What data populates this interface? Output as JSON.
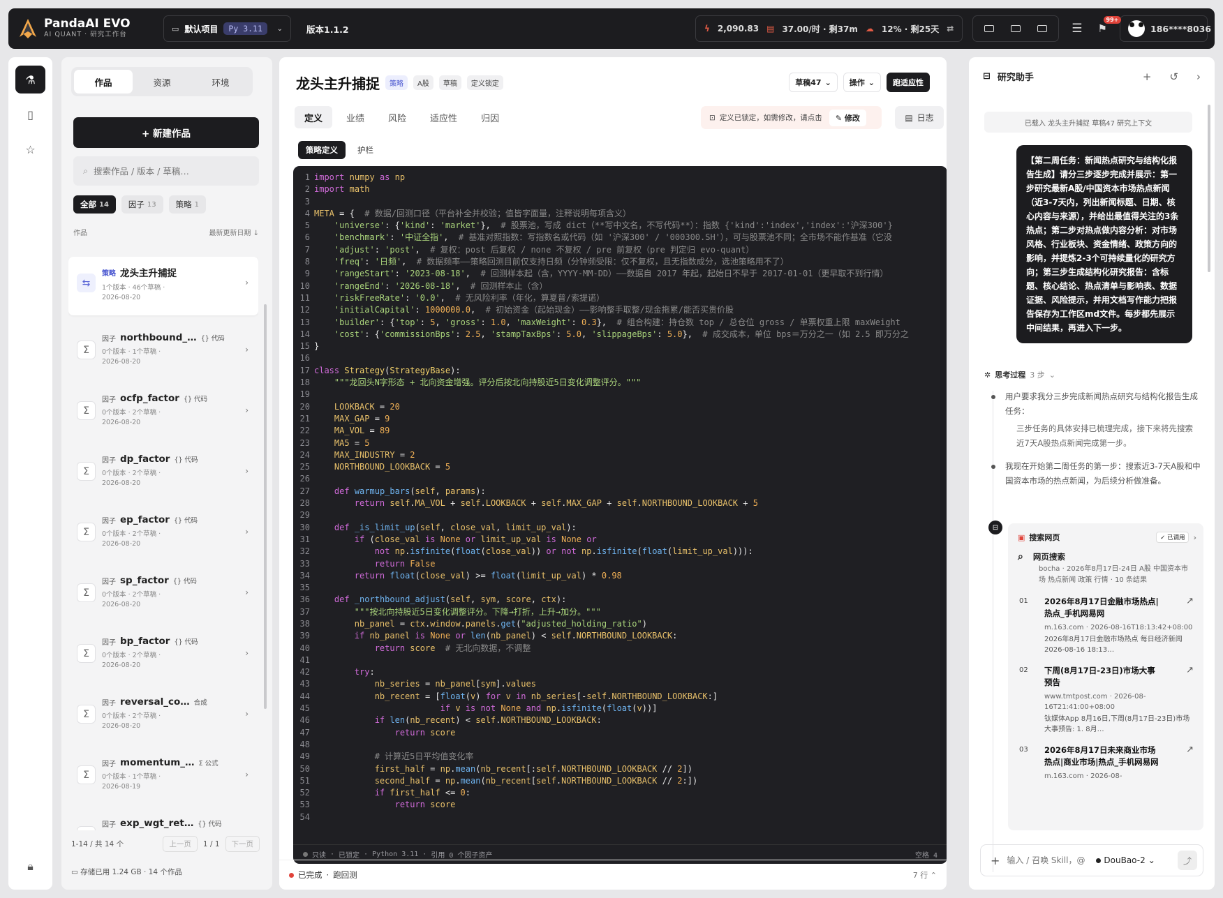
{
  "brand": {
    "name": "PandaAI EVO",
    "subtitle": "AI QUANT · 研究工作台"
  },
  "topbar": {
    "project": "默认项目",
    "python": "Py 3.11",
    "version": "版本1.1.2",
    "stat_points": "2,090.83",
    "stat_rate": "37.00/时 · 剩37m",
    "stat_pct": "12% · 剩25天",
    "notif_badge": "99+",
    "user": "186****8036"
  },
  "left": {
    "tabs": [
      "作品",
      "资源",
      "环境"
    ],
    "new_button": "+ 新建作品",
    "search_placeholder": "搜索作品 / 版本 / 草稿…",
    "filters": [
      {
        "label": "全部",
        "count": "14"
      },
      {
        "label": "因子",
        "count": "13"
      },
      {
        "label": "策略",
        "count": "1"
      }
    ],
    "list_header_left": "作品",
    "list_header_right": "最新更新日期 ↓",
    "items": [
      {
        "kind": "策略",
        "name": "龙头主升捕捉",
        "tag": "",
        "meta": "1个版本 · 46个草稿 ·",
        "date": "2026-08-20"
      },
      {
        "kind": "因子",
        "name": "northbound_…",
        "tag": "{} 代码",
        "meta": "0个版本 · 1个草稿 ·",
        "date": "2026-08-20"
      },
      {
        "kind": "因子",
        "name": "ocfp_factor",
        "tag": "{} 代码",
        "meta": "0个版本 · 2个草稿 ·",
        "date": "2026-08-20"
      },
      {
        "kind": "因子",
        "name": "dp_factor",
        "tag": "{} 代码",
        "meta": "0个版本 · 2个草稿 ·",
        "date": "2026-08-20"
      },
      {
        "kind": "因子",
        "name": "ep_factor",
        "tag": "{} 代码",
        "meta": "0个版本 · 2个草稿 ·",
        "date": "2026-08-20"
      },
      {
        "kind": "因子",
        "name": "sp_factor",
        "tag": "{} 代码",
        "meta": "0个版本 · 2个草稿 ·",
        "date": "2026-08-20"
      },
      {
        "kind": "因子",
        "name": "bp_factor",
        "tag": "{} 代码",
        "meta": "0个版本 · 2个草稿 ·",
        "date": "2026-08-20"
      },
      {
        "kind": "因子",
        "name": "reversal_co…",
        "tag": "合成",
        "meta": "0个版本 · 2个草稿 ·",
        "date": "2026-08-20"
      },
      {
        "kind": "因子",
        "name": "momentum_…",
        "tag": "Σ 公式",
        "meta": "0个版本 · 1个草稿 ·",
        "date": "2026-08-19"
      },
      {
        "kind": "因子",
        "name": "exp_wgt_ret…",
        "tag": "{} 代码",
        "meta": "",
        "date": ""
      }
    ],
    "pager_info": "1-14 / 共 14 个",
    "prev": "上一页",
    "page": "1 / 1",
    "next": "下一页",
    "storage": "存储已用 1.24 GB · 14 个作品"
  },
  "center": {
    "title": "龙头主升捕捉",
    "tags": [
      "策略",
      "A股",
      "草稿",
      "定义锁定"
    ],
    "draft_btn": "草稿47",
    "ops_btn": "操作",
    "run_btn": "跑适应性",
    "tabs": [
      "定义",
      "业绩",
      "风险",
      "适应性",
      "归因"
    ],
    "lock_text": "定义已锁定，如需修改，请点击",
    "edit_btn": "修改",
    "log_btn": "日志",
    "subtabs": [
      "策略定义",
      "护栏"
    ],
    "status": {
      "mode": "只读",
      "locked": "已锁定",
      "python": "Python 3.11",
      "refs": "引用 0 个因子资产",
      "indent": "空格 4"
    },
    "footer_status": "已完成",
    "footer_action": "跑回测",
    "footer_lines": "7 行"
  },
  "code": [
    "<span class=\"k\">import</span> <span class=\"v\">numpy</span> <span class=\"k\">as</span> <span class=\"v\">np</span>",
    "<span class=\"k\">import</span> <span class=\"v\">math</span>",
    "",
    "<span class=\"v\">META</span> = {  <span class=\"c\"># 数据/回测口径（平台补全并校验；值皆字面量，注释说明每项含义）</span>",
    "    <span class=\"s\">'universe'</span>: {<span class=\"s\">'kind'</span>: <span class=\"s\">'market'</span>},  <span class=\"c\"># 股票池，写成 dict（**写中文名，不写代码**）：指数 {'kind':'index','index':'沪深300'}</span>",
    "    <span class=\"s\">'benchmark'</span>: <span class=\"s\">'中证全指'</span>,  <span class=\"c\"># 基准对照指数：写指数名或代码（如 '沪深300' / '000300.SH'），可与股票池不同；全市场不能作基准（它没</span>",
    "    <span class=\"s\">'adjust'</span>: <span class=\"s\">'post'</span>,  <span class=\"c\"># 复权：post 后复权 / none 不复权 / pre 前复权（pre 判定归 evo-quant）</span>",
    "    <span class=\"s\">'freq'</span>: <span class=\"s\">'日频'</span>,  <span class=\"c\"># 数据频率——策略回测目前仅支持日频（分钟频受限：仅不复权，且无指数成分，选池策略用不了）</span>",
    "    <span class=\"s\">'rangeStart'</span>: <span class=\"s\">'2023-08-18'</span>,  <span class=\"c\"># 回测样本起（含，YYYY-MM-DD）——数据自 2017 年起，起始日不早于 2017-01-01（更早取不到行情）</span>",
    "    <span class=\"s\">'rangeEnd'</span>: <span class=\"s\">'2026-08-18'</span>,  <span class=\"c\"># 回测样本止（含）</span>",
    "    <span class=\"s\">'riskFreeRate'</span>: <span class=\"s\">'0.0'</span>,  <span class=\"c\"># 无风险利率（年化，算夏普/索提诺）</span>",
    "    <span class=\"s\">'initialCapital'</span>: <span class=\"n\">1000000.0</span>,  <span class=\"c\"># 初始资金（起始现金）——影响整手取整/现金拖累/能否买贵价股</span>",
    "    <span class=\"s\">'builder'</span>: {<span class=\"s\">'top'</span>: <span class=\"n\">5</span>, <span class=\"s\">'gross'</span>: <span class=\"n\">1.0</span>, <span class=\"s\">'maxWeight'</span>: <span class=\"n\">0.3</span>},  <span class=\"c\"># 组合构建：持仓数 top / 总仓位 gross / 单票权重上限 maxWeight</span>",
    "    <span class=\"s\">'cost'</span>: {<span class=\"s\">'commissionBps'</span>: <span class=\"n\">2.5</span>, <span class=\"s\">'stampTaxBps'</span>: <span class=\"n\">5.0</span>, <span class=\"s\">'slippageBps'</span>: <span class=\"n\">5.0</span>},  <span class=\"c\"># 成交成本，单位 bps＝万分之一（如 2.5 即万分之</span>",
    "}",
    "",
    "<span class=\"k\">class</span> <span class=\"cl\">Strategy</span>(<span class=\"cl\">StrategyBase</span>):",
    "    <span class=\"s\">\"\"\"龙回头N字形态 + 北向资金增强。评分后按北向持股近5日变化调整评分。\"\"\"</span>",
    "",
    "    <span class=\"v\">LOOKBACK</span> = <span class=\"n\">20</span>",
    "    <span class=\"v\">MAX_GAP</span> = <span class=\"n\">9</span>",
    "    <span class=\"v\">MA_VOL</span> = <span class=\"n\">89</span>",
    "    <span class=\"v\">MA5</span> = <span class=\"n\">5</span>",
    "    <span class=\"v\">MAX_INDUSTRY</span> = <span class=\"n\">2</span>",
    "    <span class=\"v\">NORTHBOUND_LOOKBACK</span> = <span class=\"n\">5</span>",
    "",
    "    <span class=\"k\">def</span> <span class=\"f\">warmup_bars</span>(<span class=\"v\">self</span>, <span class=\"v\">params</span>):",
    "        <span class=\"k\">return</span> <span class=\"v\">self</span>.<span class=\"v\">MA_VOL</span> + <span class=\"v\">self</span>.<span class=\"v\">LOOKBACK</span> + <span class=\"v\">self</span>.<span class=\"v\">MAX_GAP</span> + <span class=\"v\">self</span>.<span class=\"v\">NORTHBOUND_LOOKBACK</span> + <span class=\"n\">5</span>",
    "",
    "    <span class=\"k\">def</span> <span class=\"f\">_is_limit_up</span>(<span class=\"v\">self</span>, <span class=\"v\">close_val</span>, <span class=\"v\">limit_up_val</span>):",
    "        <span class=\"k\">if</span> (<span class=\"v\">close_val</span> <span class=\"k\">is</span> <span class=\"n\">None</span> <span class=\"k\">or</span> <span class=\"v\">limit_up_val</span> <span class=\"k\">is</span> <span class=\"n\">None</span> <span class=\"k\">or</span>",
    "            <span class=\"k\">not</span> <span class=\"v\">np</span>.<span class=\"f\">isfinite</span>(<span class=\"f\">float</span>(<span class=\"v\">close_val</span>)) <span class=\"k\">or</span> <span class=\"k\">not</span> <span class=\"v\">np</span>.<span class=\"f\">isfinite</span>(<span class=\"f\">float</span>(<span class=\"v\">limit_up_val</span>))):",
    "            <span class=\"k\">return</span> <span class=\"n\">False</span>",
    "        <span class=\"k\">return</span> <span class=\"f\">float</span>(<span class=\"v\">close_val</span>) &gt;= <span class=\"f\">float</span>(<span class=\"v\">limit_up_val</span>) * <span class=\"n\">0.98</span>",
    "",
    "    <span class=\"k\">def</span> <span class=\"f\">_northbound_adjust</span>(<span class=\"v\">self</span>, <span class=\"v\">sym</span>, <span class=\"v\">score</span>, <span class=\"v\">ctx</span>):",
    "        <span class=\"s\">\"\"\"按北向持股近5日变化调整评分。下降→打折，上升→加分。\"\"\"</span>",
    "        <span class=\"v\">nb_panel</span> = <span class=\"v\">ctx</span>.<span class=\"v\">window</span>.<span class=\"v\">panels</span>.<span class=\"f\">get</span>(<span class=\"s\">\"adjusted_holding_ratio\"</span>)",
    "        <span class=\"k\">if</span> <span class=\"v\">nb_panel</span> <span class=\"k\">is</span> <span class=\"n\">None</span> <span class=\"k\">or</span> <span class=\"f\">len</span>(<span class=\"v\">nb_panel</span>) &lt; <span class=\"v\">self</span>.<span class=\"v\">NORTHBOUND_LOOKBACK</span>:",
    "            <span class=\"k\">return</span> <span class=\"v\">score</span>  <span class=\"c\"># 无北向数据，不调整</span>",
    "",
    "        <span class=\"k\">try</span>:",
    "            <span class=\"v\">nb_series</span> = <span class=\"v\">nb_panel</span>[<span class=\"v\">sym</span>].<span class=\"v\">values</span>",
    "            <span class=\"v\">nb_recent</span> = [<span class=\"f\">float</span>(<span class=\"v\">v</span>) <span class=\"k\">for</span> <span class=\"v\">v</span> <span class=\"k\">in</span> <span class=\"v\">nb_series</span>[-<span class=\"v\">self</span>.<span class=\"v\">NORTHBOUND_LOOKBACK</span>:]",
    "                         <span class=\"k\">if</span> <span class=\"v\">v</span> <span class=\"k\">is not</span> <span class=\"n\">None</span> <span class=\"k\">and</span> <span class=\"v\">np</span>.<span class=\"f\">isfinite</span>(<span class=\"f\">float</span>(<span class=\"v\">v</span>))]",
    "            <span class=\"k\">if</span> <span class=\"f\">len</span>(<span class=\"v\">nb_recent</span>) &lt; <span class=\"v\">self</span>.<span class=\"v\">NORTHBOUND_LOOKBACK</span>:",
    "                <span class=\"k\">return</span> <span class=\"v\">score</span>",
    "",
    "            <span class=\"c\"># 计算近5日平均值变化率</span>",
    "            <span class=\"v\">first_half</span> = <span class=\"v\">np</span>.<span class=\"f\">mean</span>(<span class=\"v\">nb_recent</span>[:<span class=\"v\">self</span>.<span class=\"v\">NORTHBOUND_LOOKBACK</span> // <span class=\"n\">2</span>])",
    "            <span class=\"v\">second_half</span> = <span class=\"v\">np</span>.<span class=\"f\">mean</span>(<span class=\"v\">nb_recent</span>[<span class=\"v\">self</span>.<span class=\"v\">NORTHBOUND_LOOKBACK</span> // <span class=\"n\">2</span>:])",
    "            <span class=\"k\">if</span> <span class=\"v\">first_half</span> &lt;= <span class=\"n\">0</span>:",
    "                <span class=\"k\">return</span> <span class=\"v\">score</span>",
    ""
  ],
  "right": {
    "title": "研究助手",
    "loaded": "已载入 龙头主升捕捉 草稿47 研究上下文",
    "user_msg": "【第二周任务：新闻热点研究与结构化报告生成】请分三步逐步完成并展示：第一步研究最新A股/中国资本市场热点新闻（近3-7天内，列出新闻标题、日期、核心内容与来源），并给出最值得关注的3条热点；第二步对热点做内容分析：对市场风格、行业板块、资金情绪、政策方向的影响，并提炼2-3个可持续量化的研究方向；第三步生成结构化研究报告：含标题、核心结论、热点清单与影响表、数据证据、风险提示，并用文档写作能力把报告保存为工作区md文件。每步都先展示中间结果，再进入下一步。",
    "think_label": "思考过程",
    "think_steps": "3 步",
    "step1": "用户要求我分三步完成新闻热点研究与结构化报告生成任务：",
    "step1_in": "三步任务的具体安排已梳理完成，接下来将先搜索近7天A股热点新闻完成第一步。",
    "step2": "我现在开始第二周任务的第一步：搜索近3-7天A股和中国资本市场的热点新闻，为后续分析做准备。",
    "tool_title": "搜索网页",
    "tool_status": "✓ 已调用",
    "ws_title": "网页搜索",
    "ws_desc": "bocha · 2026年8月17日-24日 A股 中国资本市场 热点新闻 政策 行情 · 10 条结果",
    "results": [
      {
        "no": "01",
        "title": "2026年8月17日金融市场热点|热点_手机网易网",
        "url": "m.163.com · 2026-08-16T18:13:42+08:00",
        "snippet": "2026年8月17日金融市场热点 每日经济新闻 2026-08-16 18:13…"
      },
      {
        "no": "02",
        "title": "下周(8月17日-23日)市场大事预告",
        "url": "www.tmtpost.com · 2026-08-16T21:41:00+08:00",
        "snippet": "钛媒体App 8月16日,下周(8月17日-23日)市场大事预告: 1. 8月…"
      },
      {
        "no": "03",
        "title": "2026年8月17日未来商业市场热点|商业市场|热点_手机网易网",
        "url": "m.163.com · 2026-08-",
        "snippet": ""
      }
    ],
    "input_placeholder": "输入 / 召唤 Skill，@",
    "model": "DouBao-2"
  }
}
